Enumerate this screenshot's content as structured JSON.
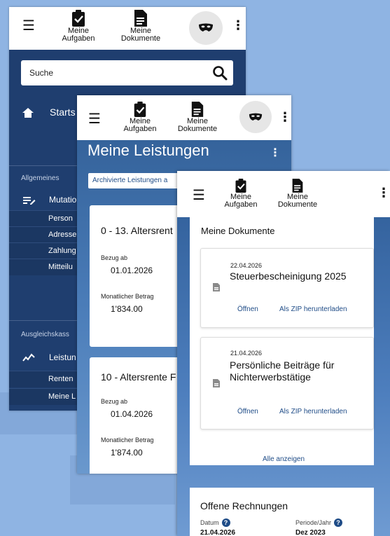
{
  "header": {
    "tasks_line1": "Meine",
    "tasks_line2": "Aufgaben",
    "docs_line1": "Meine",
    "docs_line2": "Dokumente",
    "menu_icon": "hamburger-icon",
    "mask_icon": "mask-icon",
    "more_icon": "kebab-icon"
  },
  "panel1": {
    "search_placeholder": "Suche",
    "home_label": "Starts",
    "section_general": "Allgemeines",
    "mutations_label": "Mutatio",
    "sub_items": [
      "Person",
      "Adresse",
      "Zahlung",
      "Mitteilu"
    ],
    "section_fund": "Ausgleichskass",
    "benefits_label": "Leistun",
    "sub_items2": [
      "Renten",
      "Meine L"
    ]
  },
  "panel2": {
    "title": "Meine Leistungen",
    "archive_label": "Archivierte Leistungen a",
    "cards": [
      {
        "title": "0 - 13. Altersrent",
        "bezug_label": "Bezug ab",
        "bezug_value": "01.01.2026",
        "betrag_label": "Monatlicher Betrag",
        "betrag_value": "1'834.00"
      },
      {
        "title": "10 - Altersrente F",
        "bezug_label": "Bezug ab",
        "bezug_value": "01.04.2026",
        "betrag_label": "Monatlicher Betrag",
        "betrag_value": "1'874.00"
      }
    ]
  },
  "panel3": {
    "docs_title": "Meine Dokumente",
    "documents": [
      {
        "date": "22.04.2026",
        "name_line1": "Steuerbescheinigung 2025",
        "name_line2": "",
        "open": "Öffnen",
        "zip": "Als ZIP herunterladen"
      },
      {
        "date": "21.04.2026",
        "name_line1": "Persönliche Beiträge für",
        "name_line2": "Nichterwerbstätige",
        "open": "Öffnen",
        "zip": "Als ZIP herunterladen"
      }
    ],
    "show_all": "Alle anzeigen",
    "invoices_title": "Offene Rechnungen",
    "col_date": "Datum",
    "col_period": "Periode/Jahr",
    "row_date": "21.04.2026",
    "row_period": "Dez 2023"
  },
  "colors": {
    "navy": "#1f3e6f",
    "link_blue": "#1f4c87",
    "background": "#8fb4e3"
  }
}
